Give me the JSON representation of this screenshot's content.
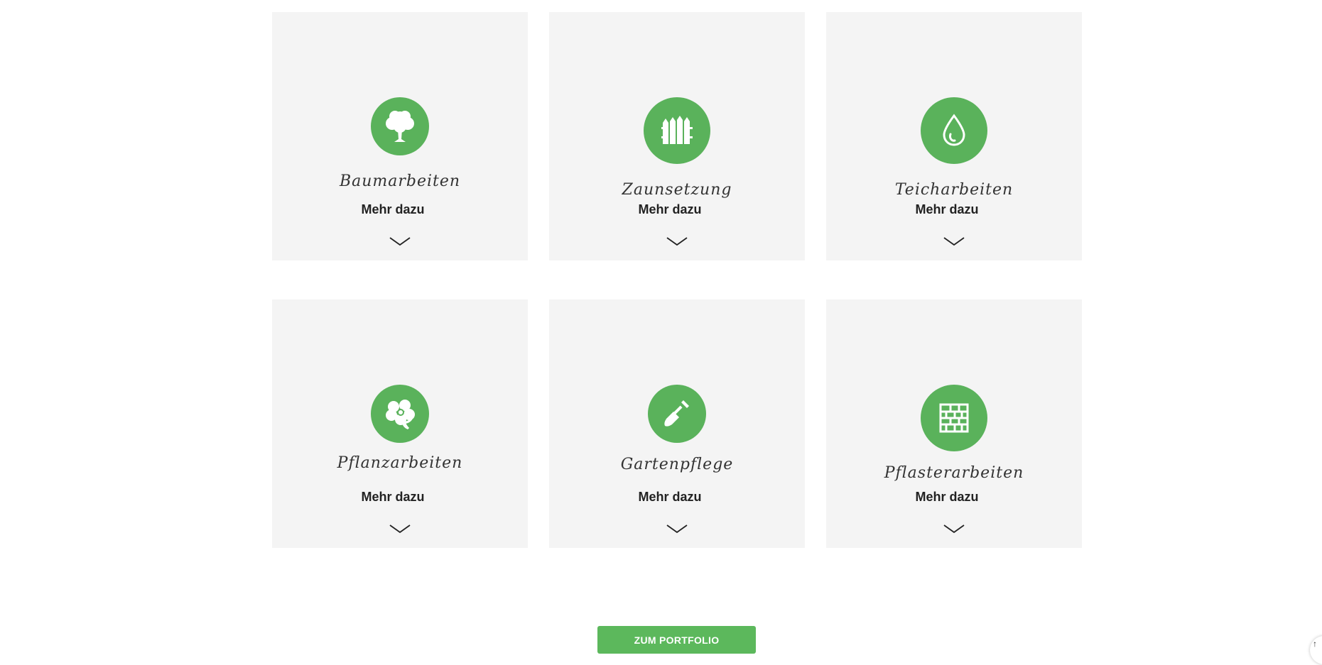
{
  "services": [
    {
      "title": "Baumarbeiten",
      "more": "Mehr dazu",
      "icon": "tree-icon"
    },
    {
      "title": "Zaunsetzung",
      "more": "Mehr dazu",
      "icon": "fence-icon"
    },
    {
      "title": "Teicharbeiten",
      "more": "Mehr dazu",
      "icon": "water-drop-icon"
    },
    {
      "title": "Pflanzarbeiten",
      "more": "Mehr dazu",
      "icon": "flower-icon"
    },
    {
      "title": "Gartenpflege",
      "more": "Mehr dazu",
      "icon": "shovel-icon"
    },
    {
      "title": "Pflasterarbeiten",
      "more": "Mehr dazu",
      "icon": "brick-wall-icon"
    }
  ],
  "portfolio_button": "ZUM PORTFOLIO",
  "colors": {
    "accent": "#5ab25b",
    "button": "#5cb85c",
    "card_bg": "#f4f4f4"
  }
}
